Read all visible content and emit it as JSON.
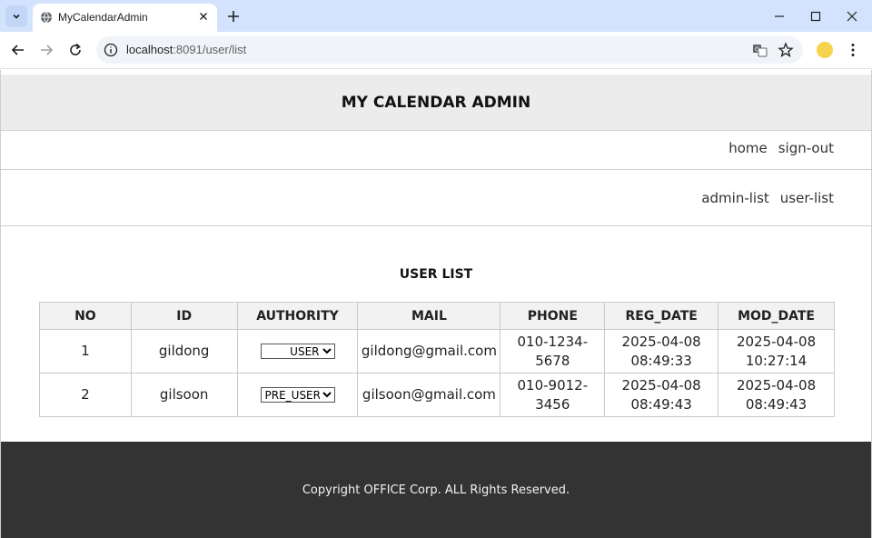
{
  "browser": {
    "tab_title": "MyCalendarAdmin",
    "url_host": "localhost",
    "url_path": ":8091/user/list"
  },
  "page": {
    "header_title": "MY CALENDAR ADMIN",
    "nav_top": {
      "home": "home",
      "sign_out": "sign-out"
    },
    "nav_sub": {
      "admin_list": "admin-list",
      "user_list": "user-list"
    },
    "list_title": "USER LIST",
    "table": {
      "headers": [
        "NO",
        "ID",
        "AUTHORITY",
        "MAIL",
        "PHONE",
        "REG_DATE",
        "MOD_DATE"
      ],
      "rows": [
        {
          "no": "1",
          "id": "gildong",
          "authority": "USER",
          "mail": "gildong@gmail.com",
          "phone": "010-1234-5678",
          "reg_date": "2025-04-08",
          "reg_time": "08:49:33",
          "mod_date": "2025-04-08",
          "mod_time": "10:27:14"
        },
        {
          "no": "2",
          "id": "gilsoon",
          "authority": "PRE_USER",
          "mail": "gilsoon@gmail.com",
          "phone": "010-9012-3456",
          "reg_date": "2025-04-08",
          "reg_time": "08:49:43",
          "mod_date": "2025-04-08",
          "mod_time": "08:49:43"
        }
      ]
    },
    "footer": "Copyright OFFICE Corp. ALL Rights Reserved."
  },
  "colors": {
    "tabbar_bg": "#d3e3fd",
    "header_bg": "#ececec",
    "footer_bg": "#333333"
  }
}
